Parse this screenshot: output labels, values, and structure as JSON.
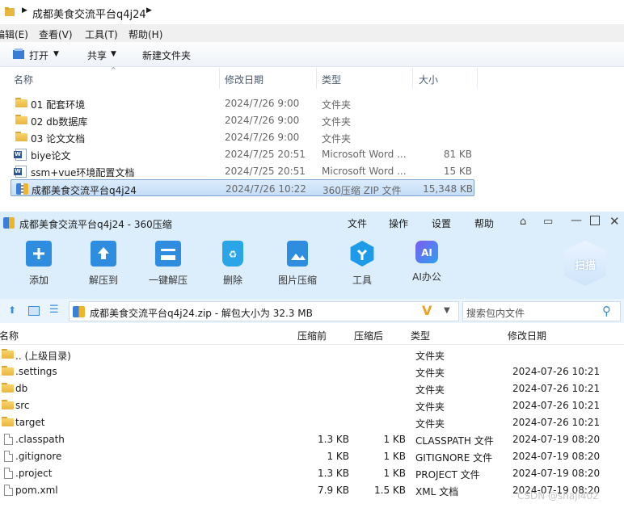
{
  "explorer": {
    "breadcrumb": "成都美食交流平台q4j24",
    "menu": [
      "编辑(E)",
      "查看(V)",
      "工具(T)",
      "帮助(H)"
    ],
    "toolbar": {
      "open": "打开",
      "share": "共享",
      "new_folder": "新建文件夹"
    },
    "columns": {
      "name": "名称",
      "date": "修改日期",
      "type": "类型",
      "size": "大小"
    },
    "files": [
      {
        "name": "01 配套环境",
        "date": "2024/7/26 9:00",
        "type": "文件夹",
        "size": "",
        "icon": "folder-icon"
      },
      {
        "name": "02 db数据库",
        "date": "2024/7/26 9:00",
        "type": "文件夹",
        "size": "",
        "icon": "folder-icon"
      },
      {
        "name": "03 论文文档",
        "date": "2024/7/26 9:00",
        "type": "文件夹",
        "size": "",
        "icon": "folder-icon"
      },
      {
        "name": "biye论文",
        "date": "2024/7/25 20:51",
        "type": "Microsoft Word ...",
        "size": "81 KB",
        "icon": "word-doc-icon"
      },
      {
        "name": "ssm+vue环境配置文档",
        "date": "2024/7/25 20:51",
        "type": "Microsoft Word ...",
        "size": "15 KB",
        "icon": "word-doc-icon"
      },
      {
        "name": "成都美食交流平台q4j24",
        "date": "2024/7/26 10:22",
        "type": "360压缩 ZIP 文件",
        "size": "15,348 KB",
        "icon": "zip-archive-icon"
      }
    ]
  },
  "zip": {
    "title": "成都美食交流平台q4j24 - 360压缩",
    "menu": [
      "文件",
      "操作",
      "设置",
      "帮助"
    ],
    "tools": [
      "添加",
      "解压到",
      "一键解压",
      "删除",
      "图片压缩",
      "工具",
      "AI办公"
    ],
    "scan": "扫描",
    "path": "成都美食交流平台q4j24.zip - 解包大小为 32.3 MB",
    "search_placeholder": "搜索包内文件",
    "columns": {
      "name": "名称",
      "packed": "压缩前",
      "compressed": "压缩后",
      "type": "类型",
      "date": "修改日期"
    },
    "rows": [
      {
        "name": ".. (上级目录)",
        "before": "",
        "after": "",
        "type": "文件夹",
        "date": "",
        "icon": "folder-icon"
      },
      {
        "name": ".settings",
        "before": "",
        "after": "",
        "type": "文件夹",
        "date": "2024-07-26 10:21",
        "icon": "folder-icon"
      },
      {
        "name": "db",
        "before": "",
        "after": "",
        "type": "文件夹",
        "date": "2024-07-26 10:21",
        "icon": "folder-icon"
      },
      {
        "name": "src",
        "before": "",
        "after": "",
        "type": "文件夹",
        "date": "2024-07-26 10:21",
        "icon": "folder-icon"
      },
      {
        "name": "target",
        "before": "",
        "after": "",
        "type": "文件夹",
        "date": "2024-07-26 10:21",
        "icon": "folder-icon"
      },
      {
        "name": ".classpath",
        "before": "1.3 KB",
        "after": "1 KB",
        "type": "CLASSPATH 文件",
        "date": "2024-07-19 08:20",
        "icon": "file-icon"
      },
      {
        "name": ".gitignore",
        "before": "1 KB",
        "after": "1 KB",
        "type": "GITIGNORE 文件",
        "date": "2024-07-19 08:20",
        "icon": "file-icon"
      },
      {
        "name": ".project",
        "before": "1.3 KB",
        "after": "1 KB",
        "type": "PROJECT 文件",
        "date": "2024-07-19 08:20",
        "icon": "file-icon"
      },
      {
        "name": "pom.xml",
        "before": "7.9 KB",
        "after": "1.5 KB",
        "type": "XML 文档",
        "date": "2024-07-19 08:20",
        "icon": "xml-file-icon"
      }
    ],
    "watermark": "CSDN @shaji402"
  }
}
